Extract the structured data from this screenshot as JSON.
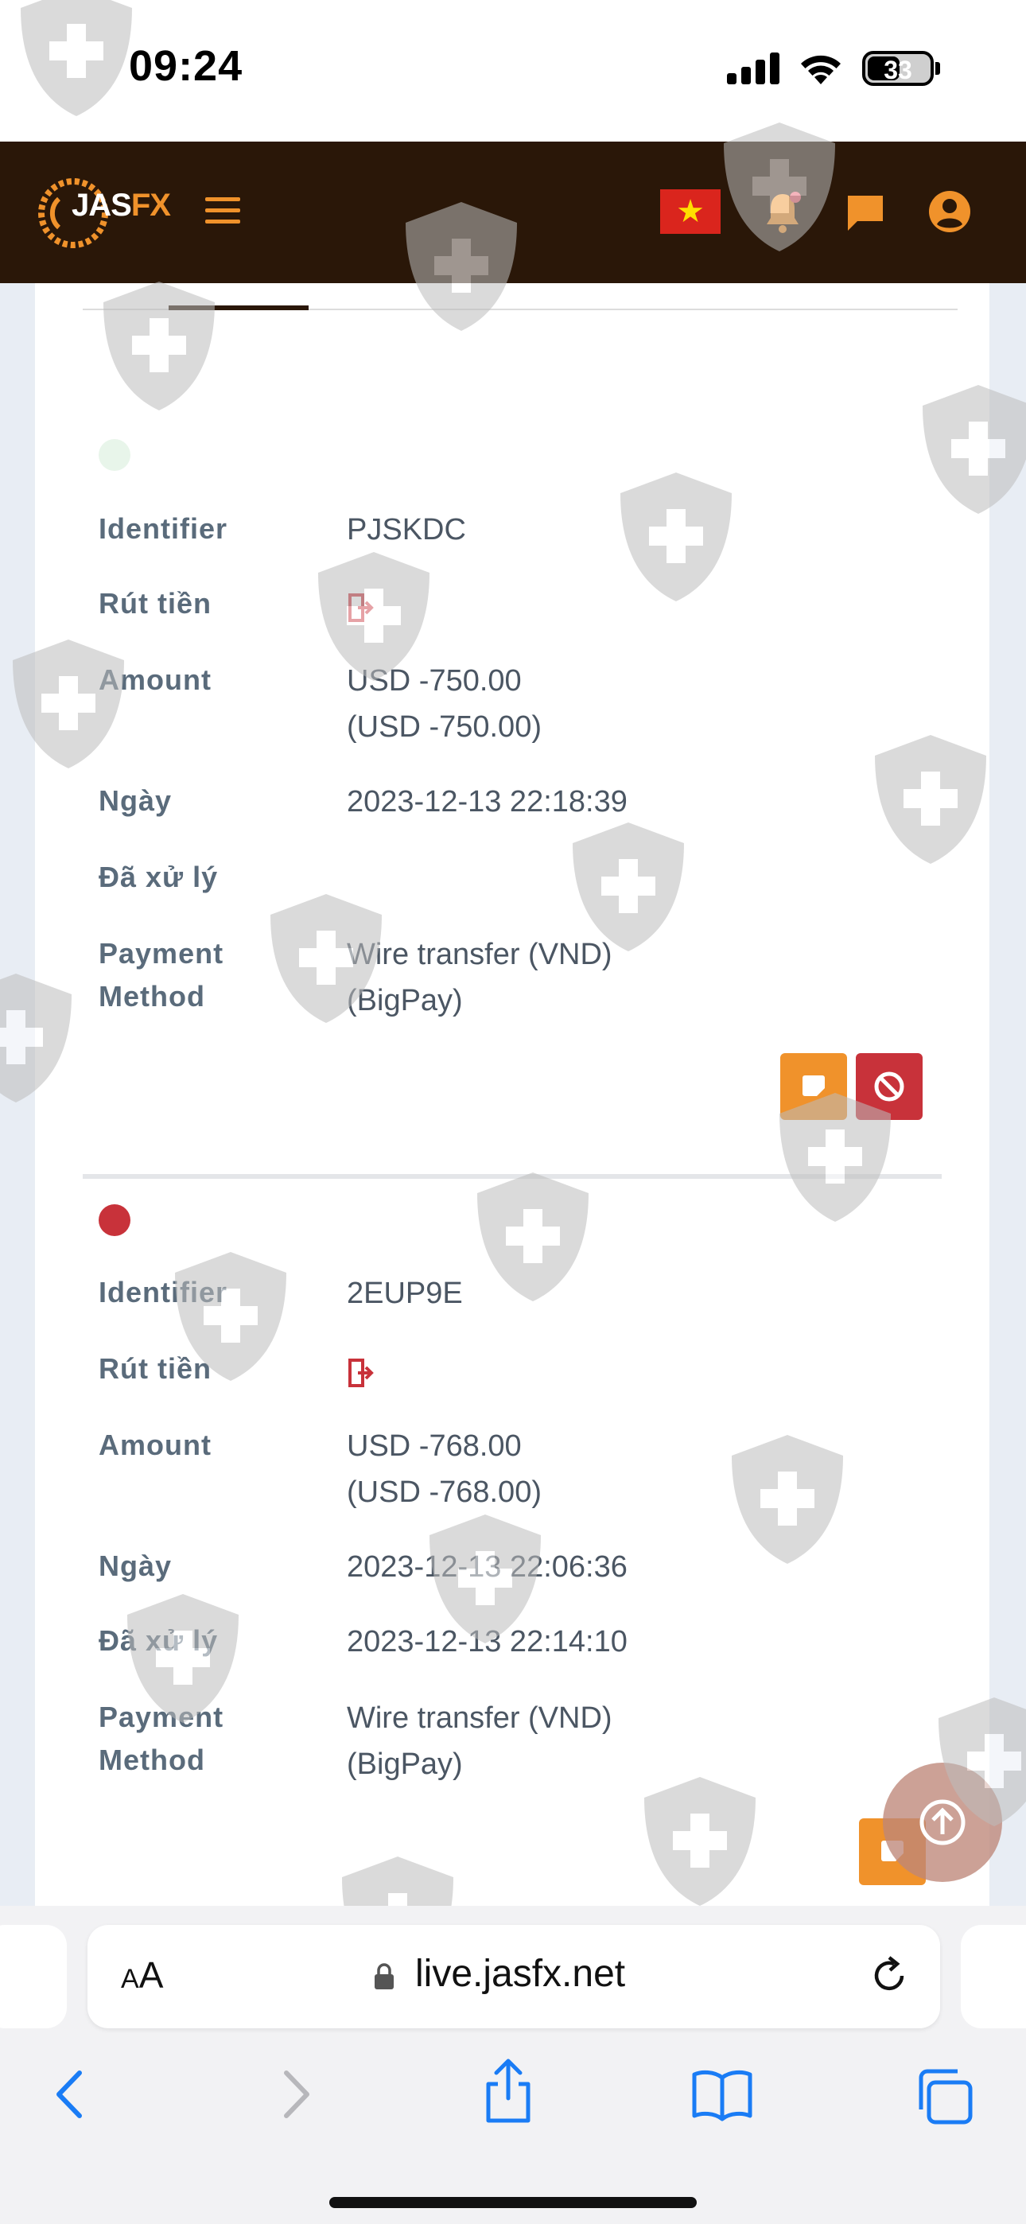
{
  "status_bar": {
    "time": "09:24",
    "battery": "33"
  },
  "header": {
    "logo_text_a": "JAS",
    "logo_text_b": "FX",
    "menu_icon": "hamburger-icon",
    "flag": "vietnam-flag",
    "icons": [
      "bell-icon",
      "chat-icon",
      "user-icon"
    ]
  },
  "labels": {
    "identifier": "Identifier",
    "type": "Rút tiền",
    "amount": "Amount",
    "date": "Ngày",
    "processed": "Đã xử lý",
    "payment_method_1": "Payment",
    "payment_method_2": "Method"
  },
  "transactions": [
    {
      "status_color": "#e8f5ea",
      "identifier": "PJSKDC",
      "amount": "USD -750.00",
      "amount_base": "(USD -750.00)",
      "date": "2023-12-13 22:18:39",
      "processed": "",
      "payment_line1": "Wire transfer (VND)",
      "payment_line2": "(BigPay)"
    },
    {
      "status_color": "#c8323a",
      "identifier": "2EUP9E",
      "amount": "USD -768.00",
      "amount_base": "(USD -768.00)",
      "date": "2023-12-13 22:06:36",
      "processed": "2023-12-13 22:14:10",
      "payment_line1": "Wire transfer (VND)",
      "payment_line2": "(BigPay)"
    }
  ],
  "browser": {
    "aa_label_small": "A",
    "aa_label_big": "A",
    "url": "live.jasfx.net"
  },
  "colors": {
    "header_bg": "#2a1708",
    "accent": "#f0922b",
    "danger": "#c8323a"
  }
}
